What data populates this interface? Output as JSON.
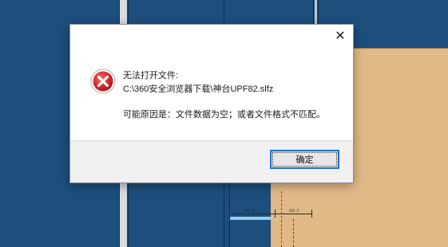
{
  "dialog": {
    "close_glyph": "✕",
    "icon": "error-icon",
    "title_line": "无法打开文件:",
    "path_line": "C:\\360安全浏览器下载\\神台UPF82.slfz",
    "reason_line": "可能原因是：文件数据为空；或者文件格式不匹配。",
    "ok_label": "确定"
  },
  "background": {
    "dim_labels": [
      "265.5",
      "265.5"
    ]
  },
  "colors": {
    "workspace_blue": "#1f5283",
    "panel_tan": "#e0b987",
    "button_focus": "#1e6fd0",
    "error_red": "#d9262c"
  }
}
